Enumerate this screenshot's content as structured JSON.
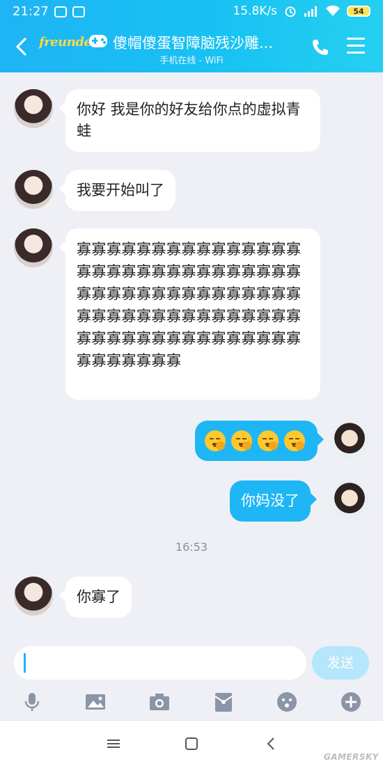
{
  "status_bar": {
    "time": "21:27",
    "network_speed": "15.8K/s",
    "battery": "54"
  },
  "header": {
    "brand": "freunde",
    "title": "傻帽傻蛋智障脑残沙雕...",
    "subtitle": "手机在线 - WiFi"
  },
  "messages": [
    {
      "side": "left",
      "text": "你好 我是你的好友给你点的虚拟青蛙"
    },
    {
      "side": "left",
      "text": "我要开始叫了"
    },
    {
      "side": "left",
      "text": "寡寡寡寡寡寡寡寡寡寡寡寡寡寡寡寡寡寡寡寡寡寡寡寡寡寡寡寡寡寡寡寡寡寡寡寡寡寡寡寡寡寡寡寡寡寡寡寡寡寡寡寡寡寡寡寡寡寡寡寡寡寡寡寡寡寡寡寡寡寡寡寡寡寡寡寡寡寡寡寡寡寡"
    },
    {
      "side": "right",
      "emoji": [
        "yawn-emoji",
        "yawn-emoji",
        "yawn-emoji",
        "yawn-emoji"
      ]
    },
    {
      "side": "right",
      "text": "你妈没了"
    },
    {
      "side": "left",
      "text": "你寡了"
    }
  ],
  "timestamp": "16:53",
  "composer": {
    "send_label": "发送"
  },
  "toolbar": [
    "microphone-icon",
    "image-icon",
    "camera-icon",
    "red-packet-icon",
    "emoji-icon",
    "plus-icon"
  ],
  "watermark": "GAMERSKY",
  "colors": {
    "header": "#17c1f3",
    "bubble_right": "#1eb6f5",
    "background": "#eef0f5"
  }
}
